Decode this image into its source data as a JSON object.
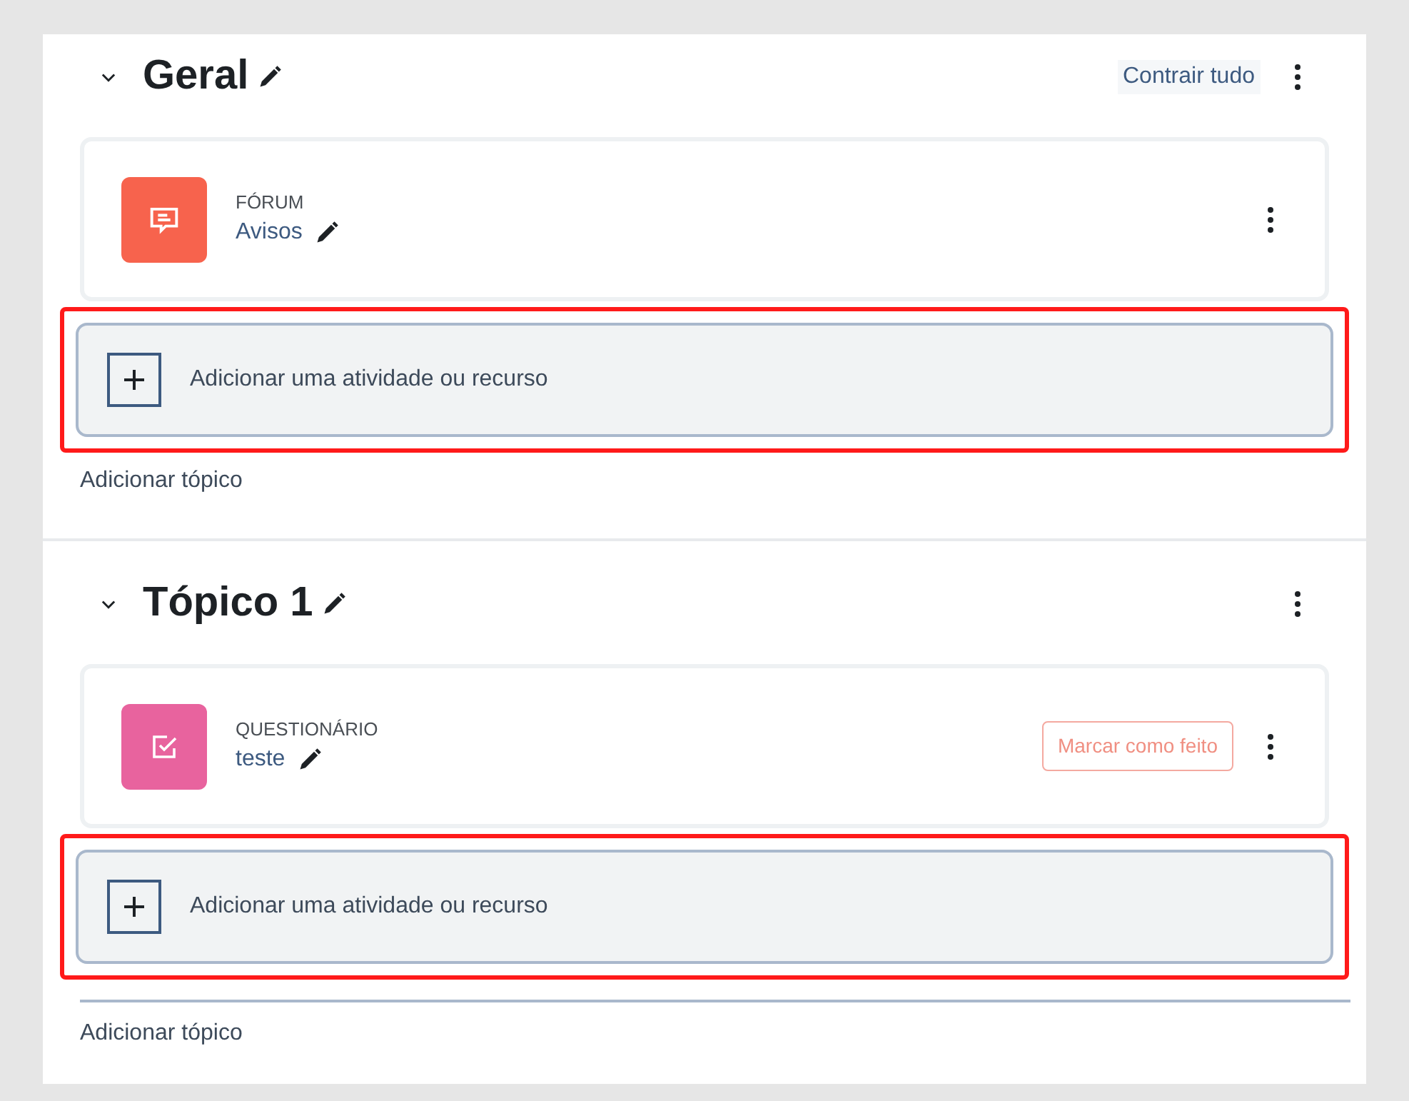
{
  "sections": [
    {
      "title": "Geral",
      "expanded": true,
      "collapse_all": "Contrair tudo",
      "activities": [
        {
          "kind": "forum",
          "type_label": "FÓRUM",
          "name": "Avisos"
        }
      ],
      "add_activity": {
        "label": "Adicionar uma atividade ou recurso",
        "highlighted": true
      },
      "add_topic": "Adicionar tópico"
    },
    {
      "title": "Tópico 1",
      "expanded": true,
      "activities": [
        {
          "kind": "quiz",
          "type_label": "QUESTIONÁRIO",
          "name": "teste",
          "completion_button": "Marcar como feito"
        }
      ],
      "add_activity": {
        "label": "Adicionar uma atividade ou recurso",
        "highlighted": true
      },
      "add_topic": "Adicionar tópico"
    }
  ]
}
